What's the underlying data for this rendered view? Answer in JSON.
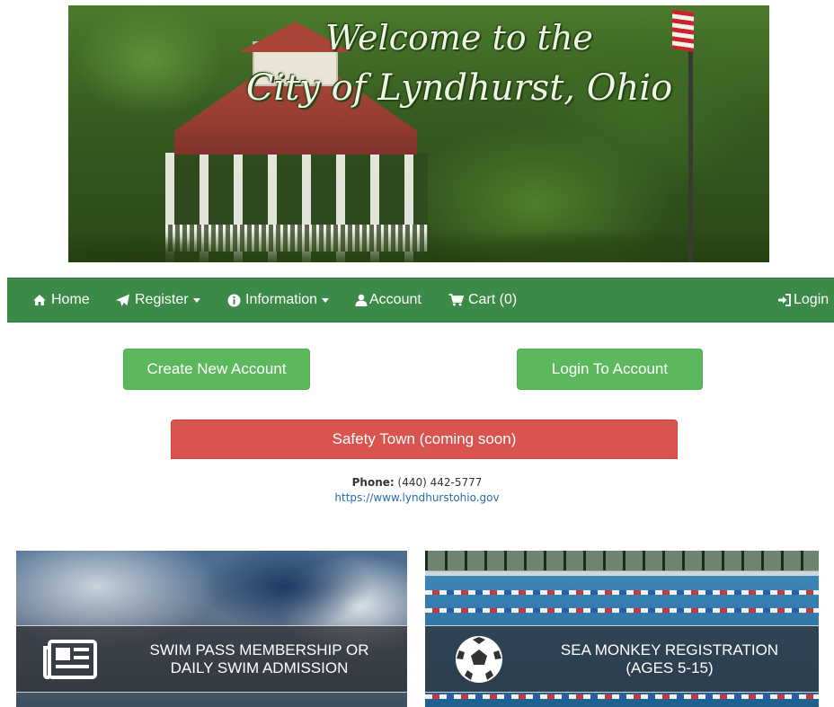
{
  "banner": {
    "title_line1": "Welcome to the",
    "title_line2": "City of Lyndhurst, Ohio"
  },
  "nav": {
    "items": [
      {
        "label": "Home",
        "icon": "home-icon"
      },
      {
        "label": "Register",
        "icon": "paper-plane-icon",
        "dropdown": true
      },
      {
        "label": "Information",
        "icon": "info-circle-icon",
        "dropdown": true
      },
      {
        "label": "Account",
        "icon": "user-icon"
      },
      {
        "label": "Cart (0)",
        "icon": "shopping-cart-icon"
      }
    ],
    "login": {
      "label": "Login",
      "icon": "sign-in-icon"
    }
  },
  "actions": {
    "create_account": "Create New Account",
    "login_account": "Login To Account",
    "safety_town": "Safety Town (coming soon)"
  },
  "contact": {
    "phone_label": "Phone:",
    "phone": "(440) 442-5777",
    "website": "https://www.lyndhurstohio.gov"
  },
  "tiles": [
    {
      "line1": "SWIM PASS MEMBERSHIP OR",
      "line2": "DAILY SWIM ADMISSION",
      "icon": "newspaper-icon"
    },
    {
      "line1": "SEA MONKEY REGISTRATION",
      "line2": "(AGES 5-15)",
      "icon": "soccer-ball-icon"
    }
  ],
  "colors": {
    "nav_bg": "#3c8a47",
    "button_green": "#5cb85c",
    "button_red": "#d9534f",
    "link": "#2a6ba8"
  }
}
